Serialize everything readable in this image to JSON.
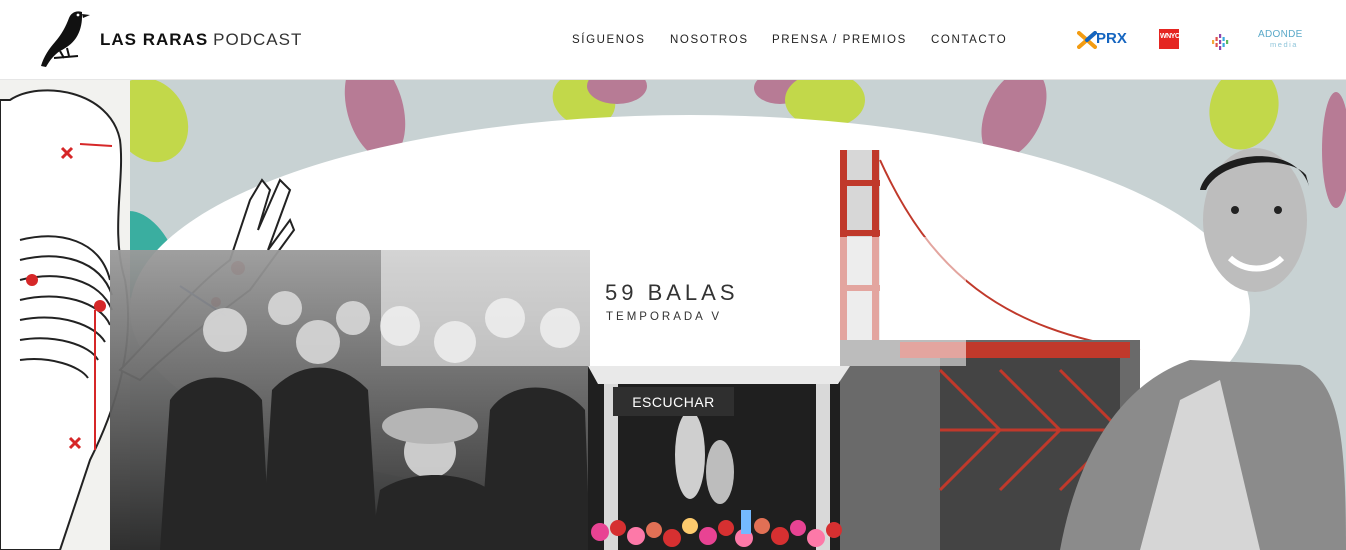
{
  "header": {
    "brand_strong": "LAS RARAS",
    "brand_light": "PODCAST",
    "nav": [
      "SÍGUENOS",
      "NOSOTROS",
      "PRENSA / PREMIOS",
      "CONTACTO"
    ],
    "partners": {
      "prx": "PRX",
      "wnyc": "WNYC",
      "adonde_top": "ADONDE",
      "adonde_bottom": "media"
    }
  },
  "hero": {
    "title": "59 BALAS",
    "subtitle": "TEMPORADA V",
    "cta_label": "ESCUCHAR"
  },
  "colors": {
    "prx_blue": "#1565c0",
    "prx_orange": "#f39c12",
    "wnyc_red": "#e52521",
    "bridge_red": "#c0392b",
    "leaf_green": "#c2d84a",
    "leaf_pink": "#b77b95",
    "leaf_teal": "#3aaea0",
    "button_bg": "#2f2f2f"
  },
  "icons": [
    "bird-logo-icon",
    "podcasts-icon",
    "chevron-right-icon"
  ]
}
